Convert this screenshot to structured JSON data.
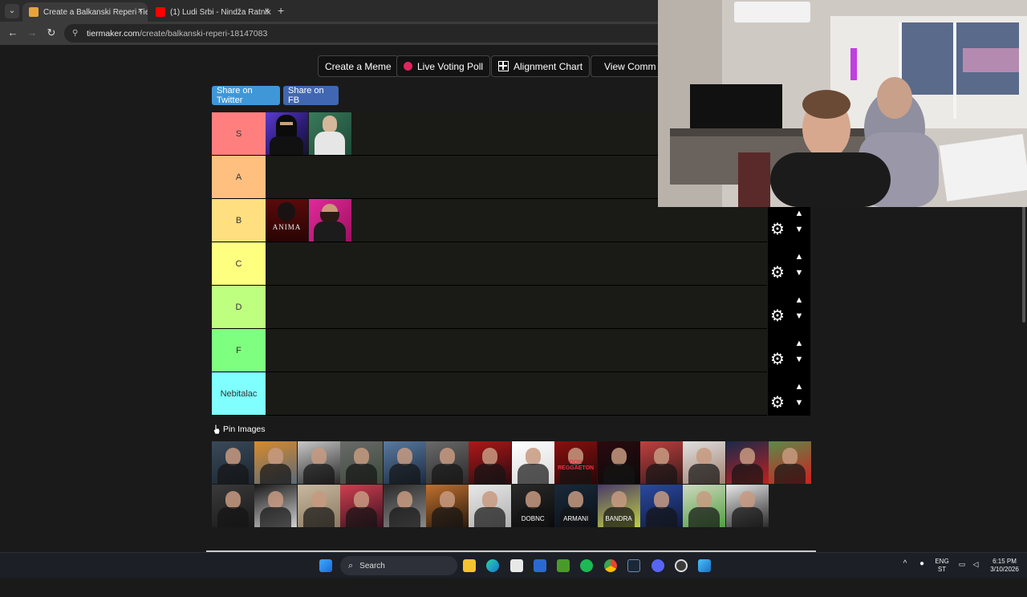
{
  "browser": {
    "tabs": [
      {
        "title": "Create a Balkanski Reperi Tier L",
        "favicon_color": "#e8a33c",
        "active": true
      },
      {
        "title": "(1) Ludi Srbi - Nindža Ratnik",
        "favicon_color": "#ff0000",
        "active": false
      }
    ],
    "close_glyph": "×",
    "new_tab_glyph": "+",
    "url_host": "tiermaker.com",
    "url_path": "/create/balkanski-reperi-18147083",
    "icons": {
      "back": "arrow-left-icon",
      "forward": "arrow-right-icon",
      "reload": "reload-icon",
      "site_info": "site-info-icon"
    }
  },
  "page": {
    "actions": [
      {
        "label": "Create a Meme",
        "icon": "none"
      },
      {
        "label": "Live Voting Poll",
        "icon": "red-dot-icon"
      },
      {
        "label": "Alignment Chart",
        "icon": "grid-icon"
      },
      {
        "label": "View Comm",
        "icon": "color-grid-icon"
      }
    ],
    "share": {
      "twitter": "Share on Twitter",
      "fb": "Share on FB"
    },
    "tiers": [
      {
        "label": "S",
        "color": "#ff7f7f",
        "images": [
          "masked-man-purple",
          "man-white-shirt-green"
        ]
      },
      {
        "label": "A",
        "color": "#ffbf7f",
        "images": []
      },
      {
        "label": "B",
        "color": "#ffdf7f",
        "images": [
          "anima-cover",
          "man-pink-background"
        ]
      },
      {
        "label": "C",
        "color": "#ffff7f",
        "images": []
      },
      {
        "label": "D",
        "color": "#bfff7f",
        "images": []
      },
      {
        "label": "F",
        "color": "#7fff7f",
        "images": []
      },
      {
        "label": "Nebitalac",
        "color": "#7fffff",
        "images": []
      }
    ],
    "tier_image_text": {
      "anima-cover": "ANIMA"
    },
    "pin_images_label": "Pin Images",
    "pool": {
      "row1": [
        {
          "colors": [
            "#3a4a5a",
            "#1c2530"
          ],
          "caption": ""
        },
        {
          "colors": [
            "#d88a2a",
            "#5a6a7a"
          ],
          "caption": ""
        },
        {
          "colors": [
            "#c8c8c8",
            "#2a2a2a"
          ],
          "caption": ""
        },
        {
          "colors": [
            "#6a6a6a",
            "#3a4a3a"
          ],
          "caption": ""
        },
        {
          "colors": [
            "#5a7aa0",
            "#1a2a40"
          ],
          "caption": ""
        },
        {
          "colors": [
            "#6a6a6a",
            "#2a2a2a"
          ],
          "caption": ""
        },
        {
          "colors": [
            "#b01818",
            "#2a0a10"
          ],
          "caption": ""
        },
        {
          "colors": [
            "#ffffff",
            "#d8d8d8"
          ],
          "caption": ""
        },
        {
          "colors": [
            "#8a1010",
            "#2a0606"
          ],
          "caption": "DON REGGAETON"
        },
        {
          "colors": [
            "#2a0a10",
            "#0a0a0a"
          ],
          "caption": ""
        },
        {
          "colors": [
            "#c04040",
            "#3a1a1a"
          ],
          "caption": ""
        },
        {
          "colors": [
            "#e0e0e0",
            "#a08070"
          ],
          "caption": ""
        },
        {
          "colors": [
            "#1a2a4a",
            "#c02020"
          ],
          "caption": ""
        },
        {
          "colors": [
            "#5a8a4a",
            "#d02020"
          ],
          "caption": ""
        }
      ],
      "row2": [
        {
          "colors": [
            "#3a3a3a",
            "#1a1a1a"
          ],
          "caption": ""
        },
        {
          "colors": [
            "#1a1a1a",
            "#d0d0d0"
          ],
          "caption": ""
        },
        {
          "colors": [
            "#c8b8a0",
            "#8a7a60"
          ],
          "caption": ""
        },
        {
          "colors": [
            "#d04050",
            "#3a1020"
          ],
          "caption": ""
        },
        {
          "colors": [
            "#2a2a2a",
            "#8a8a8a"
          ],
          "caption": ""
        },
        {
          "colors": [
            "#c07030",
            "#2a1a0a"
          ],
          "caption": ""
        },
        {
          "colors": [
            "#e8e8e8",
            "#b0b0b0"
          ],
          "caption": ""
        },
        {
          "colors": [
            "#2a2a2a",
            "#0a0a0a"
          ],
          "caption": "DOBNC"
        },
        {
          "colors": [
            "#1a2a3a",
            "#0a1018"
          ],
          "caption": "ARMANI"
        },
        {
          "colors": [
            "#4a3a6a",
            "#c0d040"
          ],
          "caption": "BANDRA"
        },
        {
          "colors": [
            "#2a4aa0",
            "#101a40"
          ],
          "caption": ""
        },
        {
          "colors": [
            "#d0d8c0",
            "#50a040"
          ],
          "caption": ""
        },
        {
          "colors": [
            "#e8e8e8",
            "#2a2a2a"
          ],
          "caption": ""
        }
      ]
    },
    "control_icons": {
      "settings": "gear-icon",
      "move_up": "chevron-up-icon",
      "move_down": "chevron-down-icon"
    }
  },
  "taskbar": {
    "search_label": "Search",
    "language": "ENG",
    "language_sub": "ST",
    "time": "6:15 PM",
    "date": "3/10/2026",
    "apps": [
      "windows-start-icon",
      "file-explorer-icon",
      "edge-icon",
      "store-icon",
      "sticky-notes-icon",
      "minecraft-icon",
      "spotify-icon",
      "chrome-icon",
      "steam-icon",
      "discord-icon",
      "obs-icon",
      "photos-icon"
    ]
  }
}
